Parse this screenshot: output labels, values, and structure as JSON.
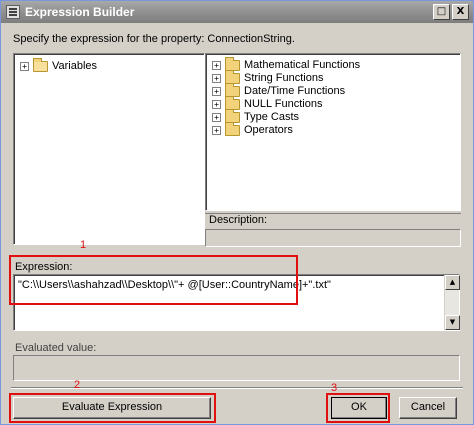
{
  "window": {
    "title": "Expression Builder",
    "maximize_glyph": "□",
    "close_glyph": "X",
    "prompt": "Specify the expression for the property: ConnectionString."
  },
  "left_tree": {
    "items": [
      {
        "label": "Variables",
        "icon": "folder-open-icon",
        "expander": "+"
      }
    ]
  },
  "right_tree": {
    "items": [
      {
        "label": "Mathematical Functions",
        "icon": "folder-icon",
        "expander": "+"
      },
      {
        "label": "String Functions",
        "icon": "folder-icon",
        "expander": "+"
      },
      {
        "label": "Date/Time Functions",
        "icon": "folder-icon",
        "expander": "+"
      },
      {
        "label": "NULL Functions",
        "icon": "folder-icon",
        "expander": "+"
      },
      {
        "label": "Type Casts",
        "icon": "folder-icon",
        "expander": "+"
      },
      {
        "label": "Operators",
        "icon": "folder-icon",
        "expander": "+"
      }
    ]
  },
  "description": {
    "label": "Description:"
  },
  "expression": {
    "label": "Expression:",
    "value": "\"C:\\\\Users\\\\ashahzad\\\\Desktop\\\\\"+ @[User::CountryName]+\".txt\"",
    "scroll_up_glyph": "▲",
    "scroll_down_glyph": "▼"
  },
  "evaluated": {
    "label": "Evaluated value:"
  },
  "buttons": {
    "evaluate": "Evaluate Expression",
    "ok": "OK",
    "cancel": "Cancel"
  },
  "annotations": {
    "one": "1",
    "two": "2",
    "three": "3",
    "color": "#e01010"
  },
  "colors": {
    "dialog_bg": "#d4d0c8",
    "titlebar": "#8c8c8c"
  }
}
